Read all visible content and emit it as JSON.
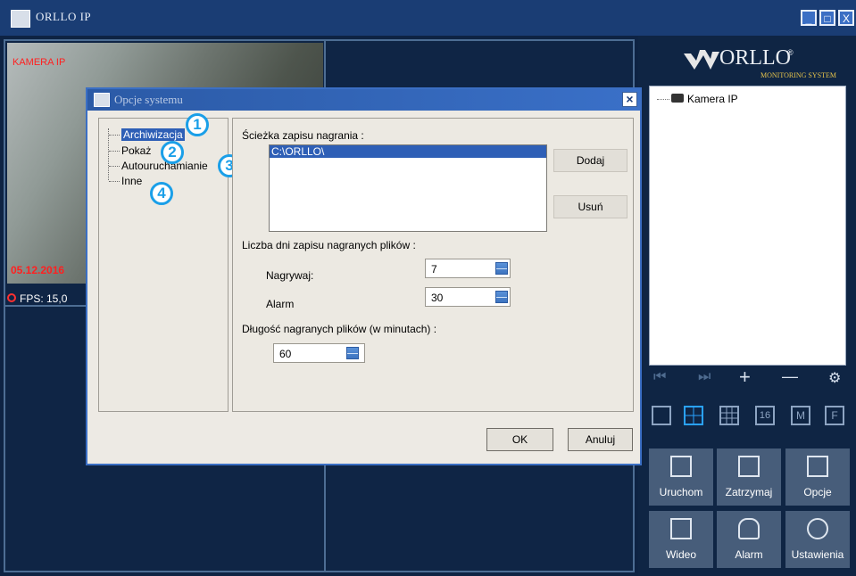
{
  "window": {
    "title": "ORLLO IP",
    "minimize": "_",
    "maximize": "□",
    "close": "X"
  },
  "camera": {
    "name": "KAMERA IP",
    "date": "05.12.2016",
    "fps": "FPS: 15,0"
  },
  "logo": {
    "brand": "ORLLO",
    "registered": "®",
    "subtitle": "MONITORING SYSTEM"
  },
  "tree": {
    "item": "Kamera IP"
  },
  "controls": {
    "prev": "⏮",
    "next": "⏭",
    "add": "+",
    "remove": "—",
    "settings": "⚙"
  },
  "layouts": [
    "1",
    "4",
    "9",
    "16",
    "M",
    "F"
  ],
  "tiles": [
    {
      "label": "Uruchom",
      "icon": "camera-group-icon"
    },
    {
      "label": "Zatrzymaj",
      "icon": "camera-group-icon"
    },
    {
      "label": "Opcje",
      "icon": "options-icon"
    },
    {
      "label": "Wideo",
      "icon": "video-file-icon"
    },
    {
      "label": "Alarm",
      "icon": "bell-icon"
    },
    {
      "label": "Ustawienia",
      "icon": "wrench-icon"
    }
  ],
  "dialog": {
    "title": "Opcje systemu",
    "close": "×",
    "nav": [
      "Archiwizacja",
      "Pokaż",
      "Autouruchamianie",
      "Inne"
    ],
    "badges": [
      "1",
      "2",
      "3",
      "4"
    ],
    "path_label": "Ścieżka zapisu nagrania :",
    "path_value": "C:\\ORLLO\\",
    "add_button": "Dodaj",
    "remove_button": "Usuń",
    "days_label": "Liczba dni zapisu nagranych plików :",
    "record_label": "Nagrywaj:",
    "record_value": "7",
    "alarm_label": "Alarm",
    "alarm_value": "30",
    "length_label": "Długość nagranych plików (w minutach) :",
    "length_value": "60",
    "ok_button": "OK",
    "cancel_button": "Anuluj"
  }
}
